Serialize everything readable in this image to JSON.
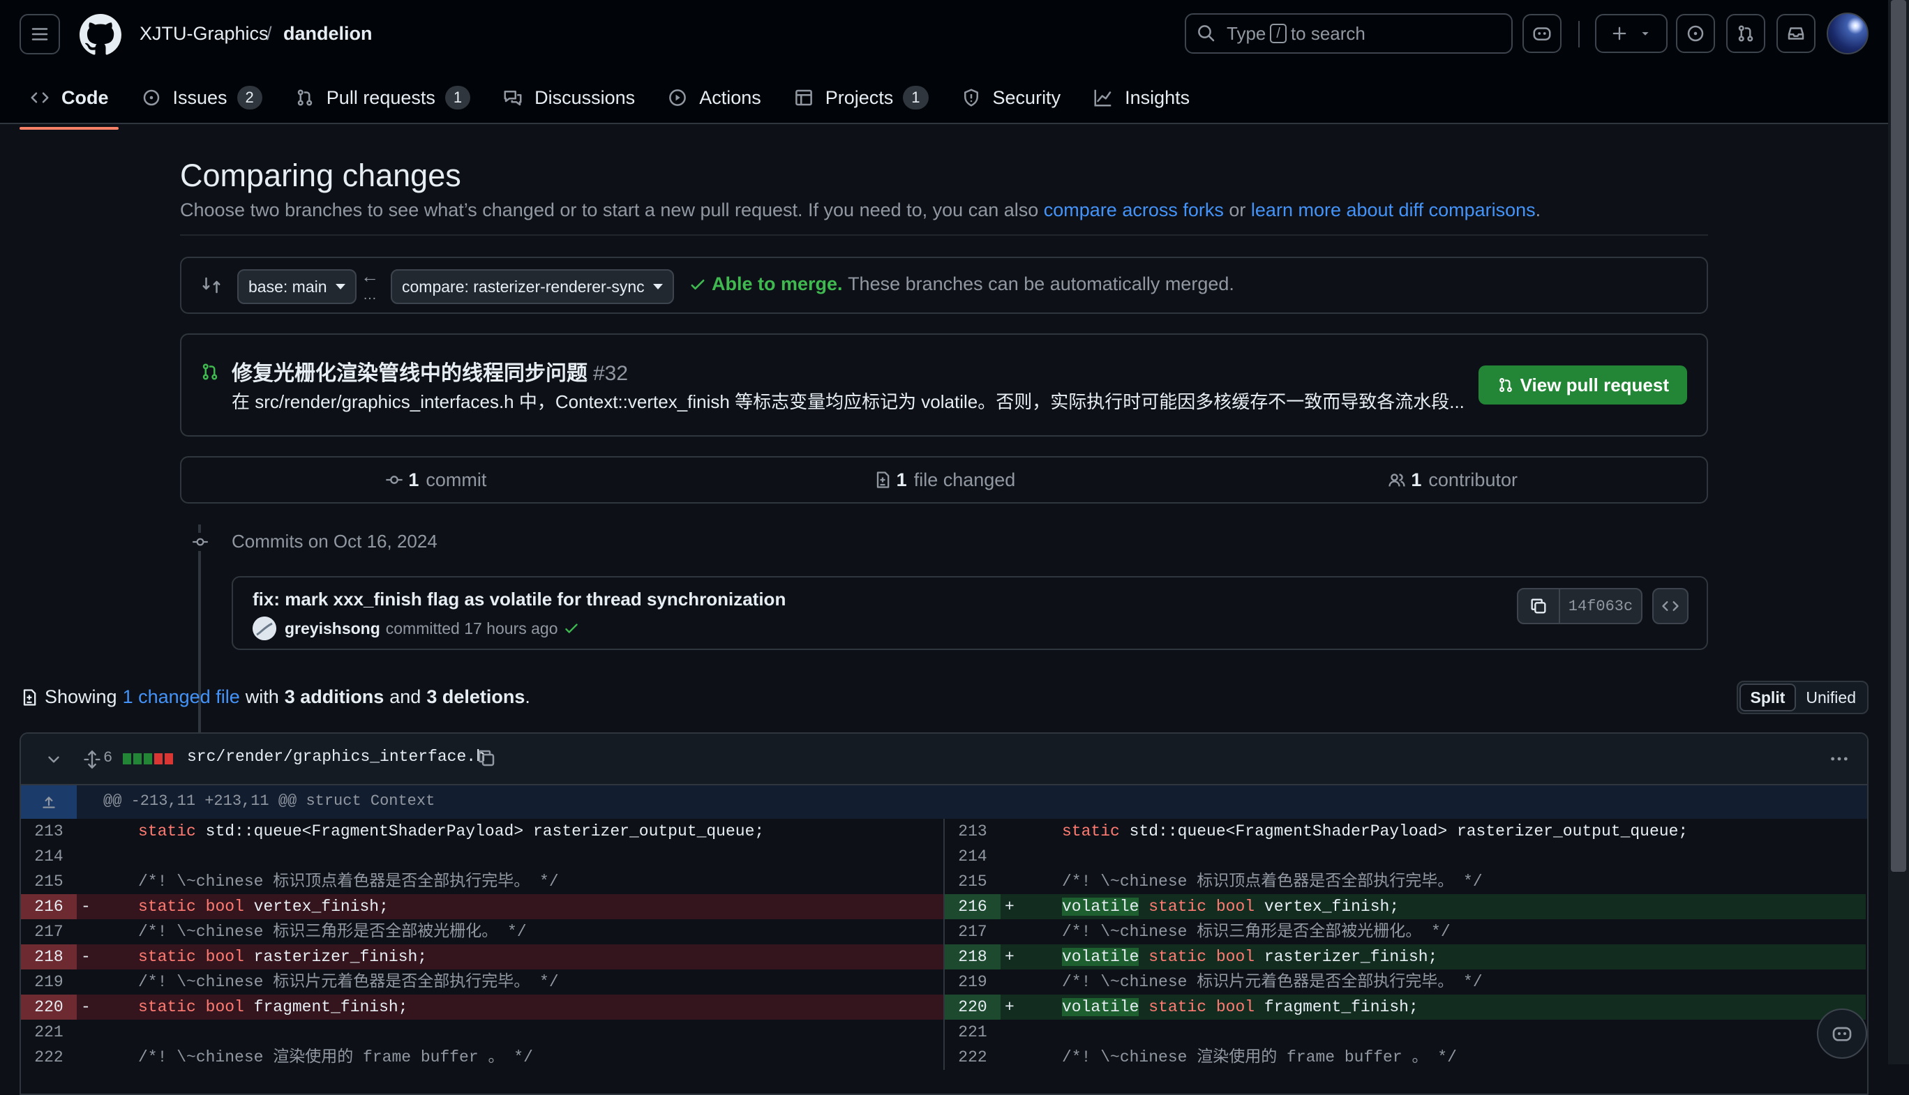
{
  "header": {
    "owner": "XJTU-Graphics",
    "separator": "/",
    "repo": "dandelion",
    "search_prefix": "Type",
    "search_key": "/",
    "search_suffix": "to search"
  },
  "nav": [
    {
      "label": "Code",
      "icon": "code-icon"
    },
    {
      "label": "Issues",
      "count": "2",
      "icon": "issue-icon"
    },
    {
      "label": "Pull requests",
      "count": "1",
      "icon": "pull-request-icon"
    },
    {
      "label": "Discussions",
      "icon": "discussions-icon"
    },
    {
      "label": "Actions",
      "icon": "play-icon"
    },
    {
      "label": "Projects",
      "count": "1",
      "icon": "table-icon"
    },
    {
      "label": "Security",
      "icon": "shield-icon"
    },
    {
      "label": "Insights",
      "icon": "graph-icon"
    }
  ],
  "page": {
    "title": "Comparing changes",
    "subtitle_pre": "Choose two branches to see what’s changed or to start a new pull request. If you need to, you can also",
    "link_forks": "compare across forks",
    "subtitle_or": "or",
    "link_learn": "learn more about diff comparisons",
    "subtitle_end": "."
  },
  "range": {
    "base": "base: main",
    "compare": "compare: rasterizer-renderer-sync",
    "merge_status": "Able to merge.",
    "merge_detail": "These branches can be automatically merged."
  },
  "pr": {
    "title": "修复光栅化渲染管线中的线程同步问题",
    "number": "#32",
    "description": "在 src/render/graphics_interfaces.h 中，Context::vertex_finish 等标志变量均应标记为 volatile。否则，实际执行时可能因多核缓存不一致而导致各流水段...",
    "button": "View pull request"
  },
  "stats": {
    "commits_num": "1",
    "commits_label": "commit",
    "files_num": "1",
    "files_label": "file changed",
    "contrib_num": "1",
    "contrib_label": "contributor"
  },
  "commits": {
    "date_label": "Commits on Oct 16, 2024",
    "message": "fix: mark xxx_finish flag as volatile for thread synchronization",
    "author": "greyishsong",
    "meta": "committed 17 hours ago",
    "sha": "14f063c"
  },
  "summary": {
    "showing": "Showing",
    "changed_link": "1 changed file",
    "with": "with",
    "additions": "3 additions",
    "and": "and",
    "deletions": "3 deletions",
    "end": "."
  },
  "view_toggle": {
    "split": "Split",
    "unified": "Unified"
  },
  "file": {
    "change_count": "6",
    "path": "src/render/graphics_interface.h",
    "hunk": "@@ -213,11 +213,11 @@ struct Context"
  },
  "diff": [
    {
      "ln": "213",
      "type": "ctx",
      "code": "static std::queue<FragmentShaderPayload> rasterizer_output_queue;",
      "rcode": "static std::queue<FragmentShaderPayload> rasterizer_output_queue;"
    },
    {
      "ln": "214",
      "type": "ctx",
      "code": "",
      "rcode": ""
    },
    {
      "ln": "215",
      "type": "ctx",
      "code": "/*! \\~chinese 标识顶点着色器是否全部执行完毕。 */",
      "rcode": "/*! \\~chinese 标识顶点着色器是否全部执行完毕。 */"
    },
    {
      "ln": "216",
      "type": "chg",
      "code": "static bool vertex_finish;",
      "rcode": "static bool vertex_finish;"
    },
    {
      "ln": "217",
      "type": "ctx",
      "code": "/*! \\~chinese 标识三角形是否全部被光栅化。 */",
      "rcode": "/*! \\~chinese 标识三角形是否全部被光栅化。 */"
    },
    {
      "ln": "218",
      "type": "chg",
      "code": "static bool rasterizer_finish;",
      "rcode": "static bool rasterizer_finish;"
    },
    {
      "ln": "219",
      "type": "ctx",
      "code": "/*! \\~chinese 标识片元着色器是否全部执行完毕。 */",
      "rcode": "/*! \\~chinese 标识片元着色器是否全部执行完毕。 */"
    },
    {
      "ln": "220",
      "type": "chg",
      "code": "static bool fragment_finish;",
      "rcode": "static bool fragment_finish;"
    },
    {
      "ln": "221",
      "type": "ctx",
      "code": "",
      "rcode": ""
    },
    {
      "ln": "222",
      "type": "ctx",
      "code": "/*! \\~chinese 渲染使用的 frame buffer 。 */",
      "rcode": "/*! \\~chinese 渲染使用的 frame buffer 。 */"
    }
  ],
  "diff_marks": {
    "del": "-",
    "add": "+",
    "added_keyword": "volatile"
  },
  "colors": {
    "accent_underline": "#f78166",
    "link": "#4493f8",
    "success": "#3fb950",
    "button_green": "#238636"
  }
}
